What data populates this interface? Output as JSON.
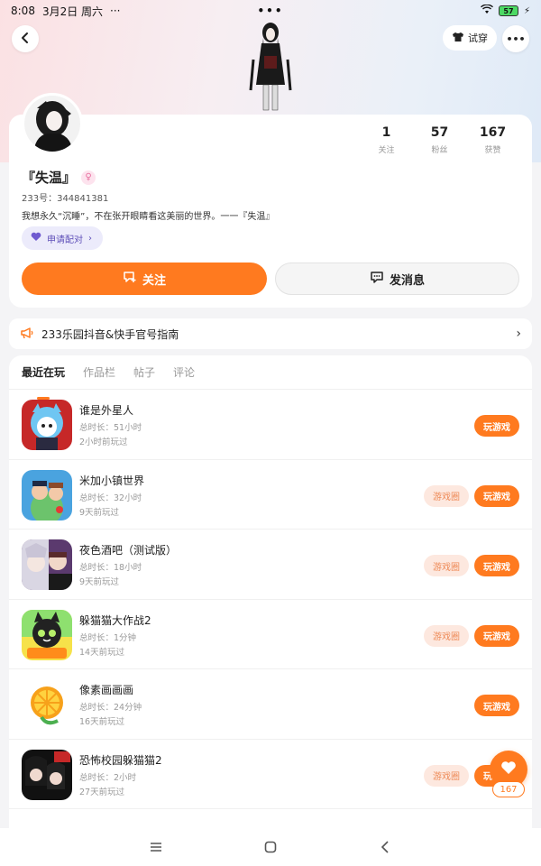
{
  "status_bar": {
    "time": "8:08",
    "date": "3月2日 周六",
    "extra": "··· ",
    "center_dots": "•••",
    "battery": "57"
  },
  "header": {
    "tryon_label": "试穿",
    "more_label": "•••"
  },
  "profile": {
    "nickname": "『失温』",
    "uid_label": "233号：344841381",
    "bio": "我想永久“沉睡”，不在张开眼睛看这美丽的世界。一一『失温』",
    "pair_label": "申请配对",
    "stats": [
      {
        "num": "1",
        "label": "关注"
      },
      {
        "num": "57",
        "label": "粉丝"
      },
      {
        "num": "167",
        "label": "获赞"
      }
    ],
    "follow_label": "关注",
    "message_label": "发消息"
  },
  "guide_banner": {
    "text": "233乐园抖音&快手官号指南"
  },
  "tabs": [
    {
      "label": "最近在玩",
      "active": true
    },
    {
      "label": "作品栏",
      "active": false
    },
    {
      "label": "帖子",
      "active": false
    },
    {
      "label": "评论",
      "active": false
    }
  ],
  "games": [
    {
      "name": "谁是外星人",
      "duration": "总时长：51小时",
      "last": "2小时前玩过",
      "circle": false
    },
    {
      "name": "米加小镇世界",
      "duration": "总时长：32小时",
      "last": "9天前玩过",
      "circle": true
    },
    {
      "name": "夜色酒吧（测试版）",
      "duration": "总时长：18小时",
      "last": "9天前玩过",
      "circle": true
    },
    {
      "name": "躲猫猫大作战2",
      "duration": "总时长：1分钟",
      "last": "14天前玩过",
      "circle": true
    },
    {
      "name": "像素画画画",
      "duration": "总时长：24分钟",
      "last": "16天前玩过",
      "circle": false
    },
    {
      "name": "恐怖校园躲猫猫2",
      "duration": "总时长：2小时",
      "last": "27天前玩过",
      "circle": true
    }
  ],
  "buttons": {
    "play_label": "玩游戏",
    "circle_label": "游戏圈"
  },
  "like_fab": {
    "count": "167"
  },
  "colors": {
    "accent": "#ff7a1f",
    "circle_bg": "#fde8df",
    "pair_bg": "#ecebfb"
  }
}
